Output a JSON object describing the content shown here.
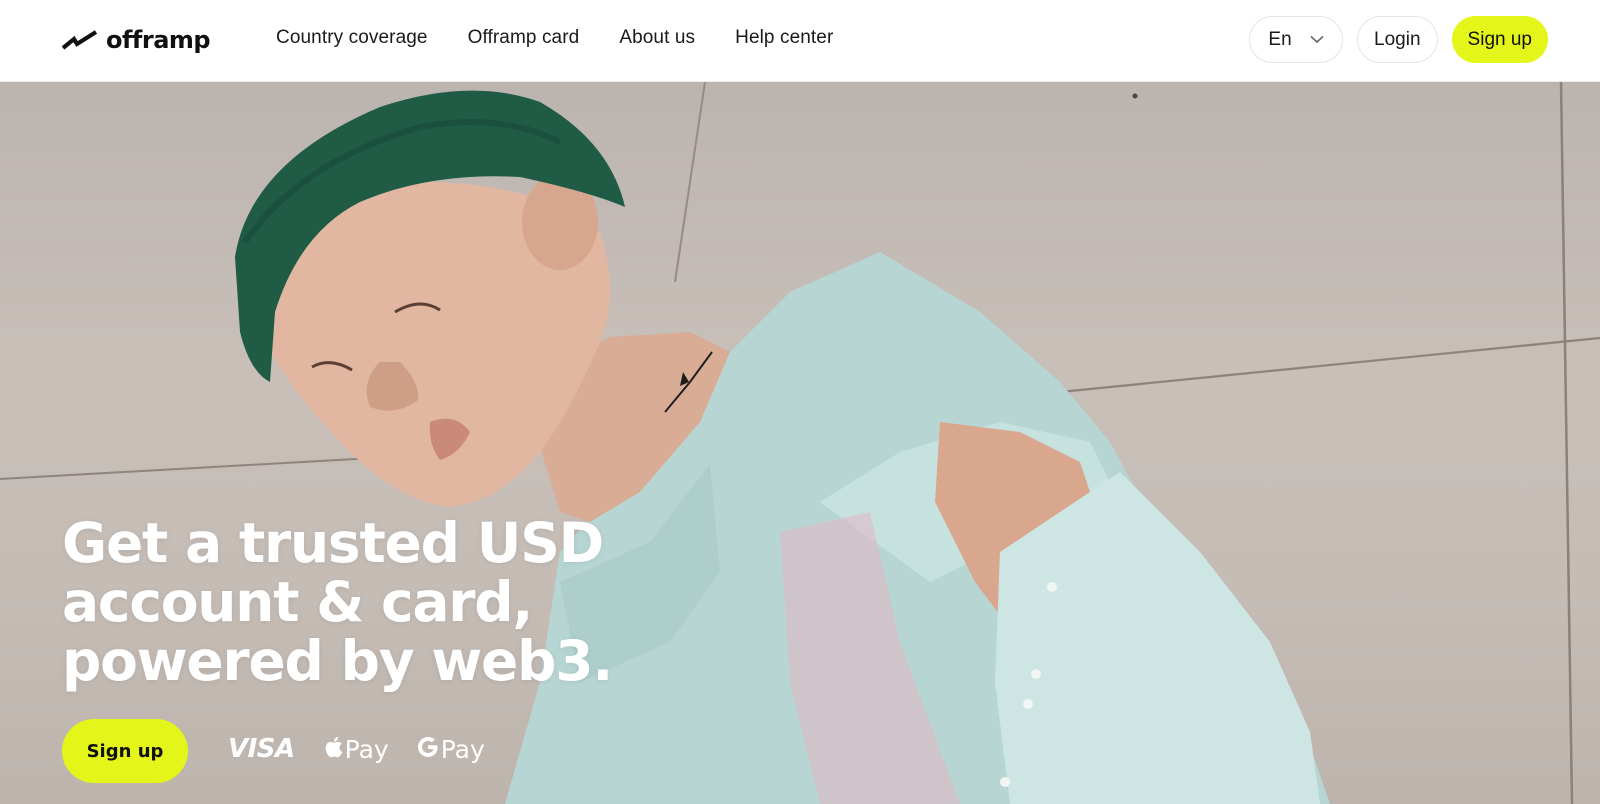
{
  "brand": {
    "name": "offramp",
    "accent_color": "#e4f51a"
  },
  "nav": {
    "items": [
      {
        "label": "Country coverage"
      },
      {
        "label": "Offramp card"
      },
      {
        "label": "About us"
      },
      {
        "label": "Help center"
      }
    ]
  },
  "header": {
    "language": "En",
    "login_label": "Login",
    "signup_label": "Sign up"
  },
  "hero": {
    "headline_lines": [
      "Get a trusted USD",
      "account & card,",
      "powered by web3."
    ],
    "cta_label": "Sign up",
    "payment_methods": {
      "visa": "VISA",
      "apple_pay": "Pay",
      "google_pay": "Pay"
    }
  },
  "icons": {
    "logo": "offramp-logo-icon",
    "language_chevron": "chevron-down-icon",
    "apple": "apple-icon",
    "google": "google-g-icon"
  }
}
